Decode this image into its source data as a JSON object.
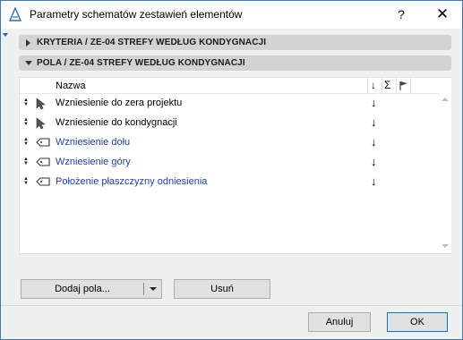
{
  "window": {
    "title": "Parametry schematów zestawień elementów",
    "help_label": "?",
    "close_label": "✕"
  },
  "sections": {
    "criteria_label": "KRYTERIA / ZE-04 STREFY WEDŁUG KONDYGNACJI",
    "fields_label": "POLA / ZE-04 STREFY WEDŁUG KONDYGNACJI"
  },
  "list": {
    "header_name": "Nazwa",
    "header_sort": "↓",
    "header_sum": "Σ",
    "rows": [
      {
        "label": "Wzniesienie do zera projektu",
        "icon": "cursor-icon",
        "sort": "↓",
        "color": "#000000"
      },
      {
        "label": "Wzniesienie do kondygnacji",
        "icon": "cursor-icon",
        "sort": "↓",
        "color": "#000000"
      },
      {
        "label": "Wzniesienie dołu",
        "icon": "zone-tag-icon",
        "sort": "↓",
        "color": "#1d3fb8"
      },
      {
        "label": "Wzniesienie góry",
        "icon": "zone-tag-icon",
        "sort": "↓",
        "color": "#1d3fb8"
      },
      {
        "label": "Położenie płaszczyzny odniesienia",
        "icon": "zone-tag-icon",
        "sort": "↓",
        "color": "#1d3fb8"
      }
    ]
  },
  "buttons": {
    "add_fields": "Dodaj pola...",
    "remove": "Usuń",
    "cancel": "Anuluj",
    "ok": "OK"
  },
  "colors": {
    "accent": "#0078d7",
    "link_text": "#1d3fb8"
  }
}
